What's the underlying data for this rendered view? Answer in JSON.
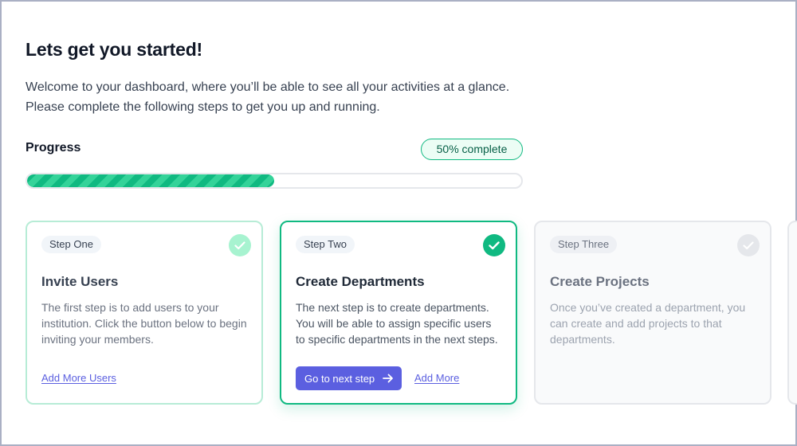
{
  "header": {
    "title": "Lets get you started!",
    "intro": "Welcome to your dashboard, where you’ll be able to see all your activities at a glance. Please complete the following steps to get you up and running."
  },
  "progress": {
    "label": "Progress",
    "badge": "50% complete",
    "percent": 50
  },
  "steps": [
    {
      "pill": "Step One",
      "title": "Invite Users",
      "description": "The first step is to add users to your institution. Click the button below to begin inviting your members.",
      "link": "Add More Users",
      "completed": true
    },
    {
      "pill": "Step Two",
      "title": "Create Departments",
      "description": "The next step is to create departments. You will be able to assign specific users to specific departments in the next steps.",
      "button": "Go to next step",
      "link": "Add More",
      "completed": true
    },
    {
      "pill": "Step Three",
      "title": "Create Projects",
      "description": "Once you’ve created a department, you can create and add projects to that departments.",
      "completed": false
    }
  ],
  "colors": {
    "accent": "#10b981",
    "button": "#5b5fe0"
  }
}
